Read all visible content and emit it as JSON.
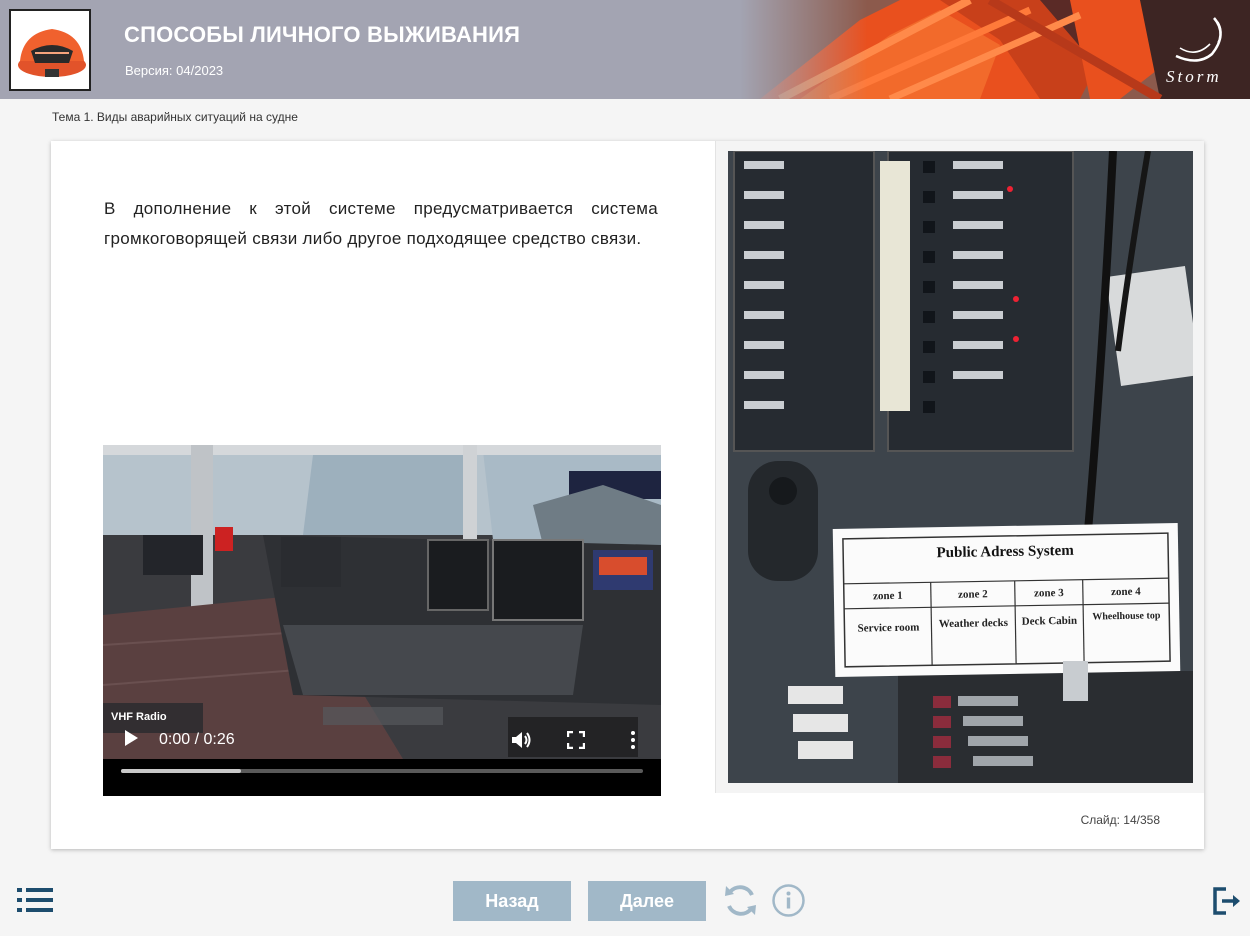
{
  "header": {
    "title": "СПОСОБЫ ЛИЧНОГО ВЫЖИВАНИЯ",
    "version": "Версия: 04/2023",
    "brand": "Storm",
    "bg_color": "#a3a4b2"
  },
  "breadcrumb": "Тема 1. Виды аварийных ситуаций на судне",
  "slide": {
    "text": "В дополнение к этой системе предусматривается система громкоговорящей связи либо другое подходящее средство связи.",
    "video": {
      "time": "0:00 / 0:26",
      "progress": 0.23,
      "overlay_label": "VHF Radio"
    },
    "photo_table": {
      "title": "Public Adress System",
      "headers": [
        "zone 1",
        "zone 2",
        "zone 3",
        "zone 4"
      ],
      "cells": [
        "Service room",
        "Weather decks",
        "Deck Cabin",
        "Wheelhouse top"
      ]
    },
    "counter": "Слайд:  14/358"
  },
  "nav": {
    "back_label": "Назад",
    "next_label": "Далее",
    "button_color": "#a1b8c8",
    "icon_color": "#1d4d6e"
  },
  "icons": [
    "raft-logo-icon",
    "storm-logo-icon",
    "play-icon",
    "volume-icon",
    "fullscreen-icon",
    "more-icon",
    "menu-list-icon",
    "reload-icon",
    "info-icon",
    "exit-icon"
  ]
}
